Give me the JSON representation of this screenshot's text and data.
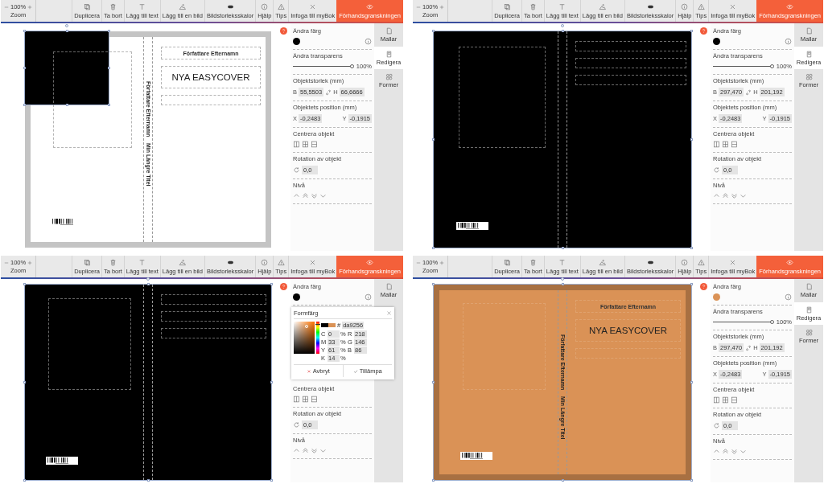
{
  "screens": [
    {
      "toolbar": {
        "zoom": {
          "value": "100%",
          "label": "Zoom"
        },
        "tools": [
          {
            "kind": "duplicate",
            "label": "Duplicera"
          },
          {
            "kind": "delete",
            "label": "Ta bort"
          },
          {
            "kind": "text",
            "label": "Lägg till text"
          },
          {
            "kind": "image",
            "label": "Lägg till en bild"
          },
          {
            "kind": "toggle",
            "label": "Bildstorleksskalor"
          },
          {
            "kind": "help",
            "label": "Hjälp"
          },
          {
            "kind": "tips",
            "label": "Tips"
          },
          {
            "kind": "close",
            "label": "Infoga till myBok"
          }
        ],
        "preview": "Förhandsgranskningen"
      },
      "book": {
        "kind": "plain",
        "selected": false,
        "objects": [
          {
            "kind": "square",
            "selected": true
          }
        ],
        "front_boxes": [
          {
            "kind": "author",
            "text": "Författare Efternamn"
          },
          {
            "kind": "title",
            "text": "NYA EASYCOVER"
          },
          {
            "kind": "empty"
          }
        ],
        "spine_texts": [
          "Författare Efternamn",
          "Min Längre Titel"
        ]
      },
      "panel": [
        {
          "kind": "color",
          "label": "Ändra färg",
          "color": "#000000"
        },
        {
          "kind": "slider",
          "label": "Ändra transparens",
          "level": 1,
          "reading": "100%"
        },
        {
          "kind": "size",
          "label": "Objektstorlek (mm)",
          "fields": [
            {
              "axis": "B",
              "value": "55,5503"
            },
            {
              "axis": "H",
              "value": "66,6666"
            }
          ]
        },
        {
          "kind": "position",
          "label": "Objektets position (mm)",
          "fields": [
            {
              "axis": "X",
              "value": "-0,2483"
            },
            {
              "axis": "Y",
              "value": "-0,1915"
            }
          ]
        },
        {
          "kind": "center",
          "label": "Centrera objekt"
        },
        {
          "kind": "rotation",
          "label": "Rotation av objekt",
          "value": "0,0"
        },
        {
          "kind": "level",
          "label": "Nivå"
        }
      ],
      "tabs": [
        {
          "kind": "templates",
          "label": "Mallar",
          "selected": false
        },
        {
          "kind": "edit",
          "label": "Redigera",
          "selected": true
        },
        {
          "kind": "shapes",
          "label": "Former",
          "selected": false
        }
      ]
    },
    {
      "toolbar": {
        "zoom": {
          "value": "100%",
          "label": "Zoom"
        },
        "tools": [
          {
            "kind": "duplicate",
            "label": "Duplicera"
          },
          {
            "kind": "delete",
            "label": "Ta bort"
          },
          {
            "kind": "text",
            "label": "Lägg till text"
          },
          {
            "kind": "image",
            "label": "Lägg till en bild"
          },
          {
            "kind": "toggle",
            "label": "Bildstorleksskalor"
          },
          {
            "kind": "help",
            "label": "Hjälp"
          },
          {
            "kind": "tips",
            "label": "Tips"
          },
          {
            "kind": "close",
            "label": "Infoga till myBok"
          }
        ],
        "preview": "Förhandsgranskningen"
      },
      "book": {
        "kind": "filled",
        "selected": true,
        "front_boxes": [
          {
            "kind": "empty"
          },
          {
            "kind": "empty"
          },
          {
            "kind": "empty"
          }
        ]
      },
      "panel": [
        {
          "kind": "color",
          "label": "Ändra färg",
          "color": "#000000"
        },
        {
          "kind": "slider",
          "label": "Ändra transparens",
          "level": 1,
          "reading": "100%"
        },
        {
          "kind": "size",
          "label": "Objektstorlek (mm)",
          "fields": [
            {
              "axis": "B",
              "value": "297,470"
            },
            {
              "axis": "H",
              "value": "201,192"
            }
          ]
        },
        {
          "kind": "position",
          "label": "Objektets position (mm)",
          "fields": [
            {
              "axis": "X",
              "value": "-0,2483"
            },
            {
              "axis": "Y",
              "value": "-0,1915"
            }
          ]
        },
        {
          "kind": "center",
          "label": "Centrera objekt"
        },
        {
          "kind": "rotation",
          "label": "Rotation av objekt",
          "value": "0,0"
        },
        {
          "kind": "level",
          "label": "Nivå"
        }
      ],
      "tabs": [
        {
          "kind": "templates",
          "label": "Mallar",
          "selected": false
        },
        {
          "kind": "edit",
          "label": "Redigera",
          "selected": true
        },
        {
          "kind": "shapes",
          "label": "Former",
          "selected": false
        }
      ]
    },
    {
      "toolbar": {
        "zoom": {
          "value": "100%",
          "label": "Zoom"
        },
        "tools": [
          {
            "kind": "duplicate",
            "label": "Duplicera"
          },
          {
            "kind": "delete",
            "label": "Ta bort"
          },
          {
            "kind": "text",
            "label": "Lägg till text"
          },
          {
            "kind": "image",
            "label": "Lägg till en bild"
          },
          {
            "kind": "toggle",
            "label": "Bildstorleksskalor"
          },
          {
            "kind": "help",
            "label": "Hjälp"
          },
          {
            "kind": "tips",
            "label": "Tips"
          },
          {
            "kind": "close",
            "label": "Infoga till myBok"
          }
        ],
        "preview": "Förhandsgranskningen"
      },
      "book": {
        "kind": "filled",
        "selected": true,
        "front_boxes": [
          {
            "kind": "empty"
          },
          {
            "kind": "empty"
          },
          {
            "kind": "empty"
          }
        ]
      },
      "panel": [
        {
          "kind": "color",
          "label": "Ändra färg",
          "color": "#000000"
        },
        {
          "kind": "picker",
          "title": "Formfärg",
          "hex_label": "#",
          "hex": "da9256",
          "cmyk": [
            {
              "label": "C",
              "value": "0",
              "unit": "%"
            },
            {
              "label": "M",
              "value": "33",
              "unit": "%"
            },
            {
              "label": "Y",
              "value": "61",
              "unit": "%"
            },
            {
              "label": "K",
              "value": "14",
              "unit": "%"
            }
          ],
          "rgb": [
            {
              "label": "R",
              "value": "218"
            },
            {
              "label": "G",
              "value": "146"
            },
            {
              "label": "B",
              "value": "86"
            }
          ],
          "buttons": [
            {
              "kind": "cancel",
              "label": "Avbryt"
            },
            {
              "kind": "apply",
              "label": "Tillämpa"
            }
          ]
        },
        {
          "kind": "center",
          "label": "Centrera objekt"
        },
        {
          "kind": "rotation",
          "label": "Rotation av objekt",
          "value": "0,0"
        },
        {
          "kind": "level",
          "label": "Nivå"
        }
      ],
      "tabs": [
        {
          "kind": "templates",
          "label": "Mallar",
          "selected": false
        }
      ]
    },
    {
      "toolbar": {
        "zoom": {
          "value": "100%",
          "label": "Zoom"
        },
        "tools": [
          {
            "kind": "duplicate",
            "label": "Duplicera"
          },
          {
            "kind": "delete",
            "label": "Ta bort"
          },
          {
            "kind": "text",
            "label": "Lägg till text"
          },
          {
            "kind": "image",
            "label": "Lägg till en bild"
          },
          {
            "kind": "toggle",
            "label": "Bildstorleksskalor"
          },
          {
            "kind": "help",
            "label": "Hjälp"
          },
          {
            "kind": "tips",
            "label": "Tips"
          },
          {
            "kind": "close",
            "label": "Infoga till myBok"
          }
        ],
        "preview": "Förhandsgranskningen"
      },
      "book": {
        "kind": "filled",
        "selected": true,
        "front_boxes": [
          {
            "kind": "author",
            "text": "Författare Efternamn"
          },
          {
            "kind": "title",
            "text": "NYA EASYCOVER"
          },
          {
            "kind": "empty"
          }
        ],
        "spine_texts": [
          "Författare Efternamn",
          "Min Längre Titel"
        ]
      },
      "panel": [
        {
          "kind": "color",
          "label": "Ändra färg",
          "color": "#da9256"
        },
        {
          "kind": "slider",
          "label": "Ändra transparens",
          "level": 1,
          "reading": "100%"
        },
        {
          "kind": "size",
          "label": "Objektstorlek (mm)",
          "fields": [
            {
              "axis": "B",
              "value": "297,470"
            },
            {
              "axis": "H",
              "value": "201,192"
            }
          ]
        },
        {
          "kind": "position",
          "label": "Objektets position (mm)",
          "fields": [
            {
              "axis": "X",
              "value": "-0,2483"
            },
            {
              "axis": "Y",
              "value": "-0,1915"
            }
          ]
        },
        {
          "kind": "center",
          "label": "Centrera objekt"
        },
        {
          "kind": "rotation",
          "label": "Rotation av objekt",
          "value": "0,0"
        },
        {
          "kind": "level",
          "label": "Nivå"
        }
      ],
      "tabs": [
        {
          "kind": "templates",
          "label": "Mallar",
          "selected": false
        },
        {
          "kind": "edit",
          "label": "Redigera",
          "selected": true
        },
        {
          "kind": "shapes",
          "label": "Former",
          "selected": false
        }
      ]
    }
  ]
}
